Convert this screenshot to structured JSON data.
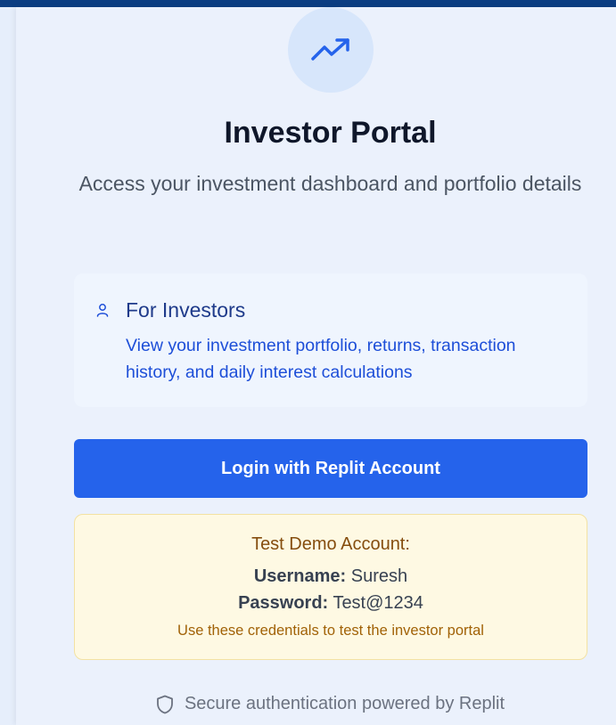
{
  "header": {
    "title": "Investor Portal",
    "subtitle": "Access your investment dashboard and portfolio details"
  },
  "info": {
    "icon": "user-icon",
    "title": "For Investors",
    "text": "View your investment portfolio, returns, transaction history, and daily interest calculations"
  },
  "login": {
    "label": "Login with Replit Account"
  },
  "demo": {
    "title": "Test Demo Account:",
    "username_label": "Username:",
    "username_value": "Suresh",
    "password_label": "Password:",
    "password_value": "Test@1234",
    "note": "Use these credentials to test the investor portal"
  },
  "footer": {
    "icon": "shield-icon",
    "text": "Secure authentication powered by Replit"
  },
  "colors": {
    "primary": "#2563eb",
    "topbar": "#0b3d82",
    "demo_bg": "#fef9e3",
    "demo_title": "#854d0e"
  }
}
